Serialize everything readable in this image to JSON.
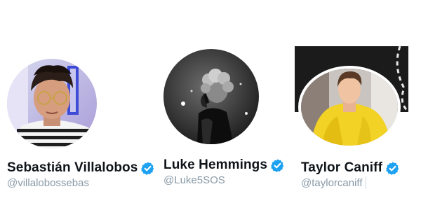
{
  "profiles": [
    {
      "name": "Sebastián Villalobos",
      "handle": "@villalobossebas",
      "verified": true,
      "avatar_icon": "profile-photo"
    },
    {
      "name": "Luke Hemmings",
      "handle": "@Luke5SOS",
      "verified": true,
      "avatar_icon": "profile-photo"
    },
    {
      "name": "Taylor Caniff",
      "handle": "@taylorcaniff",
      "verified": true,
      "avatar_icon": "profile-photo"
    }
  ],
  "colors": {
    "verified_badge": "#1da1f2",
    "name_text": "#0f1419",
    "handle_text": "#8899a6"
  }
}
